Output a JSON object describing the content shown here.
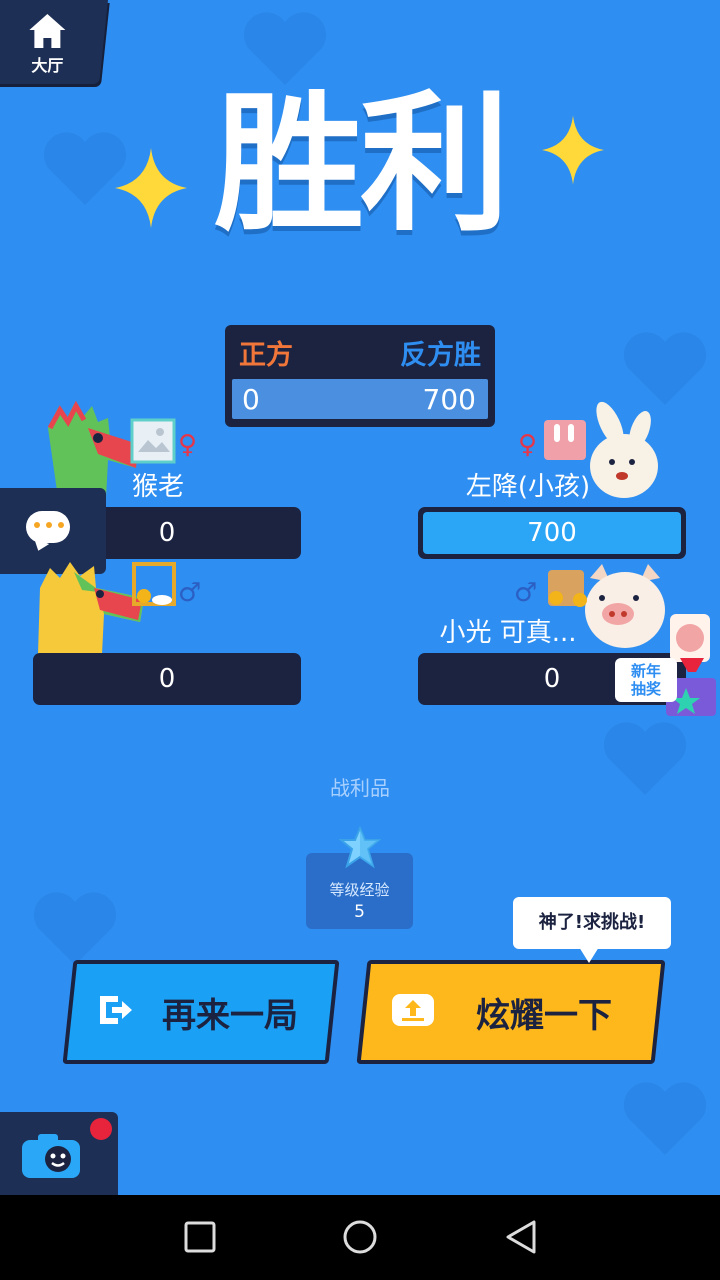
{
  "header": {
    "hall_label": "大厅",
    "title": "胜利"
  },
  "scoreboard": {
    "left_team": "正方",
    "right_team": "反方胜",
    "left_score": "0",
    "right_score": "700",
    "colors": {
      "left": "#f0763a",
      "right": "#2f8ef1"
    }
  },
  "players": [
    {
      "name": "猴老",
      "score": "0",
      "gender": "♀",
      "side": "left"
    },
    {
      "name": "左降(小孩)",
      "score": "700",
      "gender": "♀",
      "side": "right",
      "highlighted": true
    },
    {
      "name": "",
      "score": "0",
      "gender": "♂",
      "side": "left"
    },
    {
      "name": "小光 可真...",
      "score": "0",
      "gender": "♂",
      "side": "right"
    }
  ],
  "loot": {
    "title": "战利品",
    "item_label": "等级经验",
    "item_value": "5"
  },
  "actions": {
    "again_label": "再来一局",
    "show_label": "炫耀一下",
    "speech": "神了!求挑战!"
  },
  "promo": {
    "newyear_line1": "新年",
    "newyear_line2": "抽奖"
  },
  "icons": [
    "home-icon",
    "chat-icon",
    "camera-icon",
    "exit-icon",
    "share-icon",
    "star-gem-icon"
  ],
  "nav": [
    "recents",
    "home",
    "back"
  ]
}
